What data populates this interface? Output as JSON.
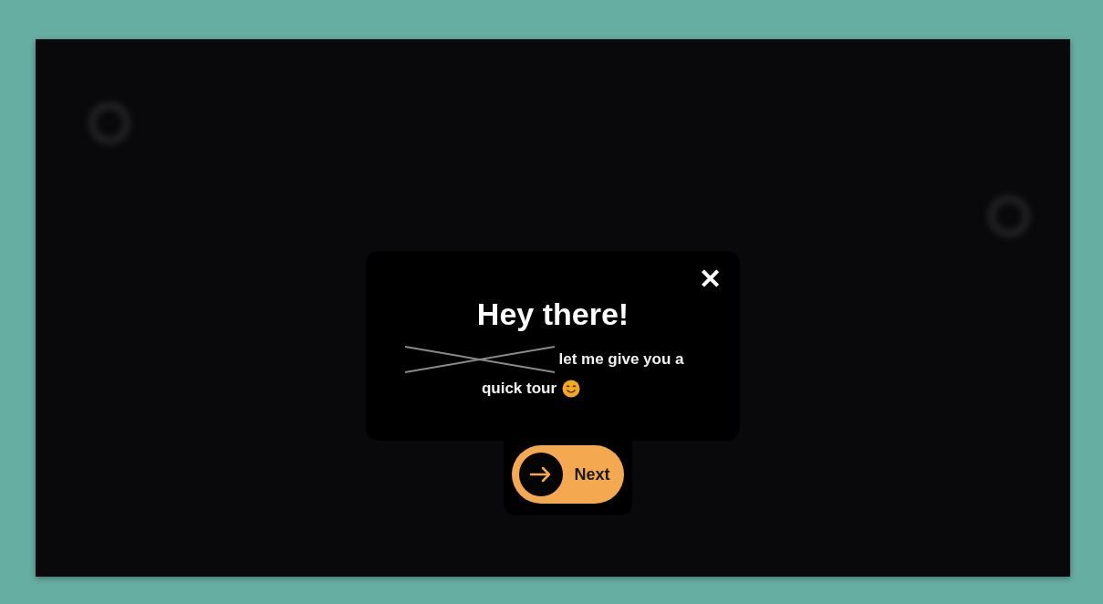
{
  "dialog": {
    "title": "Hey there!",
    "message_lines": [
      "let me give you a",
      "quick tour"
    ],
    "close_label": "✕"
  },
  "next_button": {
    "label": "Next"
  }
}
